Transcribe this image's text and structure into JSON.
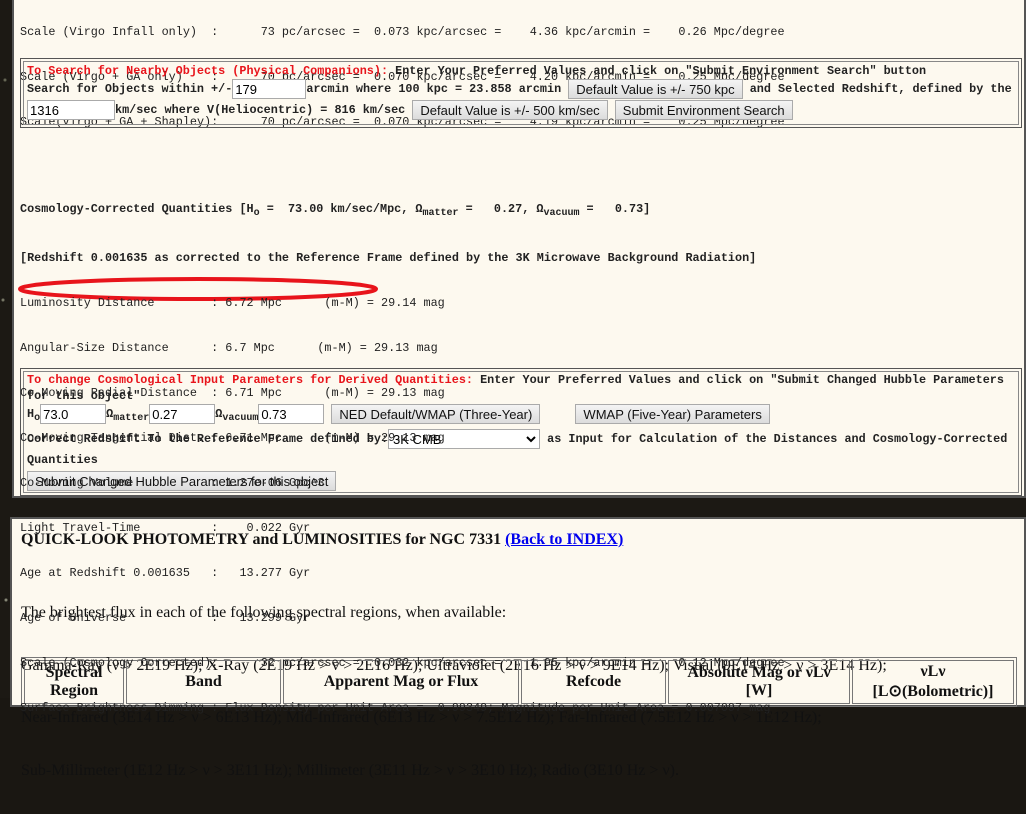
{
  "scale_lines": [
    "Scale (Virgo Infall only)  :      73 pc/arcsec =  0.073 kpc/arcsec =    4.36 kpc/arcmin =    0.26 Mpc/degree",
    "Scale (Virgo + GA only)    :      70 pc/arcsec =  0.070 kpc/arcsec =    4.20 kpc/arcmin =    0.25 Mpc/degree",
    "Scale(Virgo + GA + Shapley):      70 pc/arcsec =  0.070 kpc/arcsec =    4.19 kpc/arcmin =    0.25 Mpc/degree"
  ],
  "env_search": {
    "heading": "To Search for Nearby Objects (Physical Companions):",
    "instruction": " Enter Your Preferred Values and click on \"Submit Environment Search\" button",
    "within_label": "Search for Objects within +/-",
    "arcmin_value": "179",
    "arcmin_text": "arcmin where 100 kpc = 23.858 arcmin",
    "default_kpc_button": "Default Value is +/- 750 kpc",
    "redshift_text": " and Selected Redshift, defined by the",
    "velocity_value": "1316",
    "velocity_text": "km/sec where V(Heliocentric) = 816 km/sec",
    "default_kms_button": "Default Value is +/- 500 km/sec",
    "submit_button": "Submit Environment Search"
  },
  "cosmology": {
    "header_pre": "Cosmology-Corrected Quantities [H",
    "h_sub": "o",
    "h_val": " =  73.00 km/sec/Mpc, Ω",
    "m_sub": "matter",
    "m_val": " =   0.27, Ω",
    "v_sub": "vacuum",
    "v_val": " =   0.73]",
    "redshift_line": "[Redshift 0.001635 as corrected to the Reference Frame defined by the 3K Microwave Background Radiation]",
    "lines": [
      "Luminosity Distance        : 6.72 Mpc      (m-M) = 29.14 mag",
      "Angular-Size Distance      : 6.7 Mpc      (m-M) = 29.13 mag",
      "Co-Moving Radial Distance  : 6.71 Mpc      (m-M) = 29.13 mag",
      "Co-Moving Tangential Dist. : 6.71 Mpc      (m-M) = 29.13 mag",
      "Co-Moving Volume           : 1.27e-06 Gpc^3",
      "Light Travel-Time          :    0.022 Gyr",
      "Age at Redshift 0.001635   :   13.277 Gyr",
      "Age of Universe            :   13.299 Gyr",
      "Scale (Cosmology Corrected):      32 pc/arcsec =  0.032 kpc/arcsec =    1.95 kpc/arcmin =    0.12 Mpc/degree",
      "Surface Brightness Dimming : Flux Density per Unit Area =  0.99349; Magnitude per Unit Area = 0.007097 mag"
    ]
  },
  "hubble_form": {
    "heading": "To change Cosmological Input Parameters for Derived Quantities:",
    "instruction": " Enter Your Preferred Values and click on \"Submit Changed Hubble Parameters for this object\"",
    "h_label": "H",
    "h_sub": "o",
    "h_value": "73.0",
    "om_label": "Ω",
    "om_sub": "matter",
    "om_value": "0.27",
    "ov_label": "Ω",
    "ov_sub": "vacuum",
    "ov_value": "0.73",
    "ned_button": "NED Default/WMAP (Three-Year)",
    "wmap5_button": "WMAP (Five-Year) Parameters",
    "frame_label": "Correct Redshift To the Reference Frame defined by:",
    "frame_selected": "3K CMB",
    "frame_after": " as Input for Calculation of the Distances and Cosmology-Corrected Quantities",
    "submit_button": "Submit Changed Hubble Parameters for this object"
  },
  "photometry": {
    "title": "QUICK-LOOK PHOTOMETRY and LUMINOSITIES for NGC 7331 ",
    "back_link": "(Back to INDEX)",
    "intro": [
      "The brightest flux in each of the following spectral regions, when available:",
      "Gamma-Ray (ν > 2E19 Hz); X-Ray (2E19 Hz > ν > 2E16 Hz); Ultraviolet (2E16 Hz > ν > 9E14 Hz); Visual (9E14 Hz > ν > 3E14 Hz);",
      "Near-Infrared (3E14 Hz > ν > 6E13 Hz); Mid-Infrared (6E13 Hz > ν > 7.5E12 Hz); Far-Infrared (7.5E12 Hz > ν > 1E12 Hz);",
      "Sub-Millimeter (1E12 Hz > ν > 3E11 Hz); Millimeter (3E11 Hz > ν > 3E10 Hz); Radio (3E10 Hz > ν)."
    ],
    "columns": [
      "Spectral Region",
      "Band",
      "Apparent Mag or Flux",
      "Refcode",
      "Absolute Mag or νLν [W]",
      "νLν [L⊙(Bolometric)]"
    ]
  }
}
